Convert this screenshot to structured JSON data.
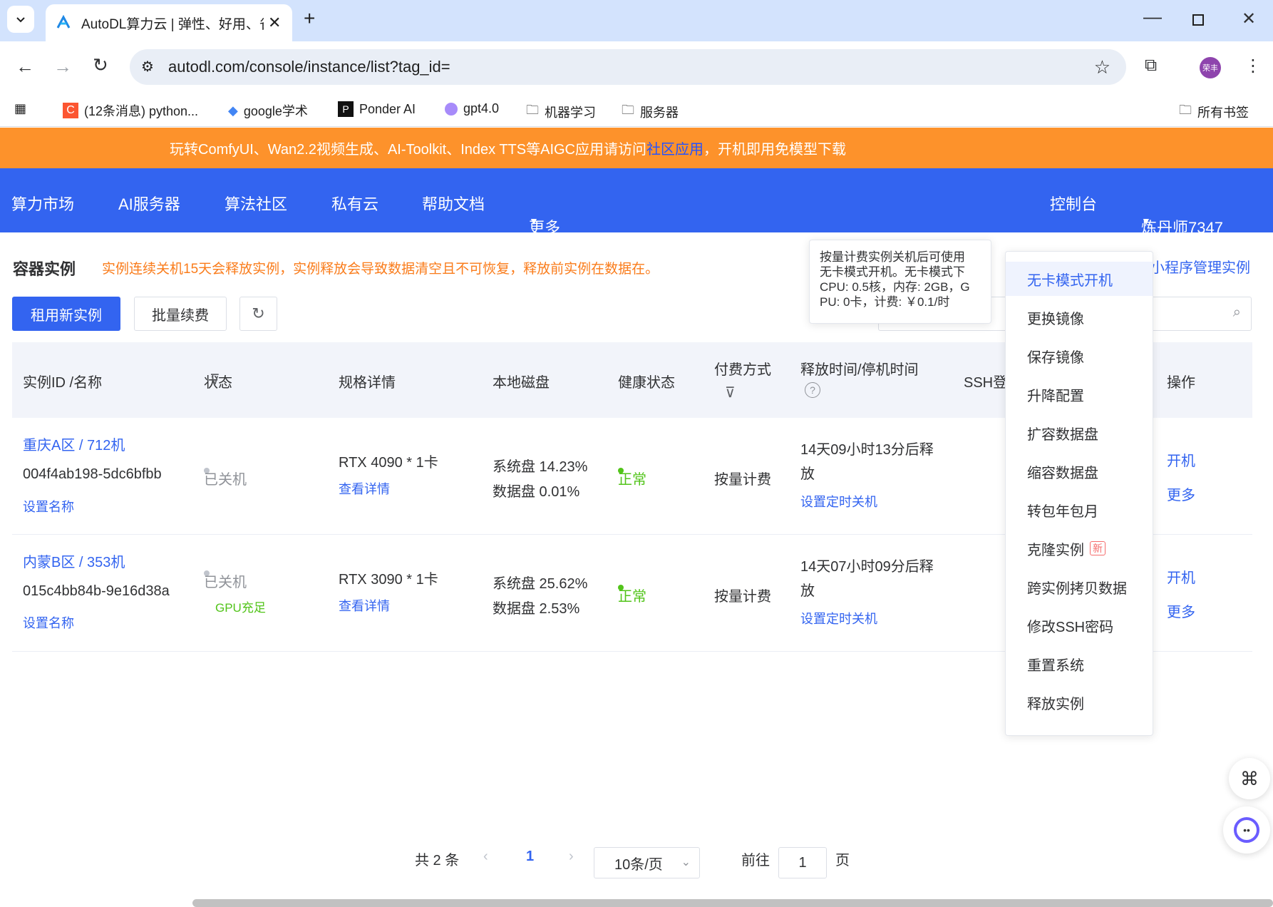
{
  "browser": {
    "tab_title": "AutoDL算力云 | 弹性、好用、省",
    "url": "autodl.com/console/instance/list?tag_id=",
    "profile_label": "荣丰",
    "bookmarks": [
      "(12条消息) python...",
      "google学术",
      "Ponder AI",
      "gpt4.0",
      "机器学习",
      "服务器"
    ],
    "all_bookmarks": "所有书签"
  },
  "banner": {
    "text_before": "玩转ComfyUI、Wan2.2视频生成、AI-Toolkit、Index TTS等AIGC应用请访问",
    "link": "社区应用",
    "text_after": "，开机即用免模型下载"
  },
  "nav": {
    "items": [
      "算力市场",
      "AI服务器",
      "算法社区",
      "私有云",
      "帮助文档",
      "更多"
    ],
    "console": "控制台",
    "user": "炼丹师7347"
  },
  "page": {
    "title": "容器实例",
    "warning": "实例连续关机15天会释放实例，实例释放会导致数据清空且不可恢复，释放前实例在数据在。",
    "mini_program_link": "小程序管理实例",
    "rent_button": "租用新实例",
    "renew_button": "批量续费"
  },
  "table": {
    "headers": {
      "id": "实例ID /名称",
      "status": "状态",
      "spec": "规格详情",
      "disk": "本地磁盘",
      "health": "健康状态",
      "billing": "付费方式",
      "release": "释放时间/停机时间",
      "ssh": "SSH登",
      "actions": "操作"
    },
    "rows": [
      {
        "region": "重庆A区 / 712机",
        "id": "004f4ab198-5dc6bfbb",
        "set_name": "设置名称",
        "status": "已关机",
        "gpu_note": "",
        "spec": "RTX 4090 * 1卡",
        "spec_link": "查看详情",
        "sys_disk": "系统盘 14.23%",
        "data_disk": "数据盘 0.01%",
        "health": "正常",
        "billing": "按量计费",
        "release_line1": "14天09小时13分后释",
        "release_line2": "放",
        "timer_link": "设置定时关机",
        "action_start": "开机",
        "action_more": "更多"
      },
      {
        "region": "内蒙B区 / 353机",
        "id": "015c4bb84b-9e16d38a",
        "set_name": "设置名称",
        "status": "已关机",
        "gpu_note": "GPU充足",
        "spec": "RTX 3090 * 1卡",
        "spec_link": "查看详情",
        "sys_disk": "系统盘 25.62%",
        "data_disk": "数据盘 2.53%",
        "health": "正常",
        "billing": "按量计费",
        "release_line1": "14天07小时09分后释",
        "release_line2": "放",
        "timer_link": "设置定时关机",
        "action_start": "开机",
        "action_more": "更多"
      }
    ]
  },
  "tooltip": {
    "lines": [
      "按量计费实例关机后可使用",
      "无卡模式开机。无卡模式下",
      "CPU: 0.5核，内存: 2GB，G",
      "PU: 0卡，计费: ￥0.1/时"
    ]
  },
  "dropdown_menu": {
    "items": [
      "无卡模式开机",
      "更换镜像",
      "保存镜像",
      "升降配置",
      "扩容数据盘",
      "缩容数据盘",
      "转包年包月",
      "克隆实例",
      "跨实例拷贝数据",
      "修改SSH密码",
      "重置系统",
      "释放实例"
    ],
    "new_badge": "新"
  },
  "pagination": {
    "total": "共 2 条",
    "current_page": "1",
    "page_size": "10条/页",
    "goto_label": "前往",
    "goto_value": "1",
    "page_suffix": "页"
  },
  "colors": {
    "brand_blue": "#3364f0",
    "banner_orange": "#fd922b",
    "warning_orange": "#fa7c1b",
    "ok_green": "#52c41a"
  }
}
